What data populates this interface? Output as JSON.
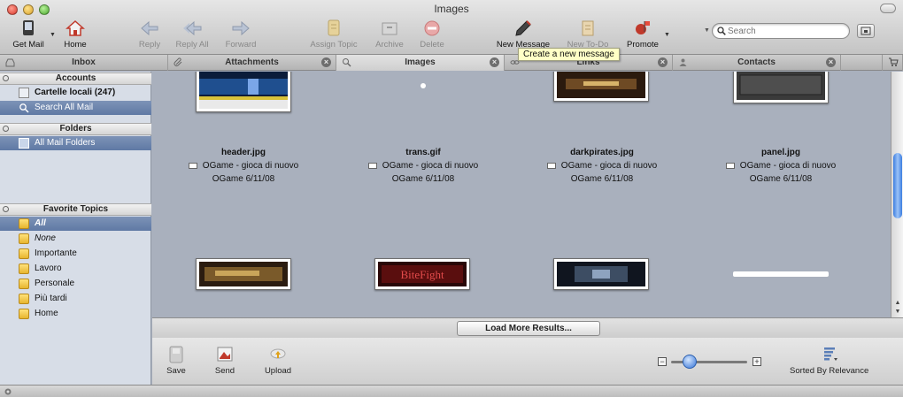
{
  "window": {
    "title": "Images"
  },
  "toolbar": {
    "get_mail": "Get Mail",
    "home": "Home",
    "reply": "Reply",
    "reply_all": "Reply All",
    "forward": "Forward",
    "assign_topic": "Assign Topic",
    "archive": "Archive",
    "delete": "Delete",
    "new_message": "New Message",
    "new_todo": "New To-Do",
    "promote": "Promote",
    "search_placeholder": "Search",
    "tooltip": "Create a new message"
  },
  "tabs": [
    {
      "label": "Inbox",
      "icon": "inbox-icon"
    },
    {
      "label": "Attachments",
      "icon": "paperclip-icon"
    },
    {
      "label": "Images",
      "icon": "image-search-icon"
    },
    {
      "label": "Links",
      "icon": "link-icon"
    },
    {
      "label": "Contacts",
      "icon": "person-icon"
    }
  ],
  "sidebar": {
    "accounts_header": "Accounts",
    "accounts": [
      {
        "label": "Cartelle locali (247)"
      },
      {
        "label": "Search All Mail"
      }
    ],
    "folders_header": "Folders",
    "folders": [
      {
        "label": "All Mail Folders"
      }
    ],
    "topics_header": "Favorite Topics",
    "topics": [
      {
        "label": "All"
      },
      {
        "label": "None"
      },
      {
        "label": "Importante"
      },
      {
        "label": "Lavoro"
      },
      {
        "label": "Personale"
      },
      {
        "label": "Più tardi"
      },
      {
        "label": "Home"
      }
    ]
  },
  "images": [
    {
      "name": "header.jpg",
      "subject": "OGame - gioca di nuovo",
      "sender": "OGame",
      "date": "6/11/08"
    },
    {
      "name": "trans.gif",
      "subject": "OGame - gioca di nuovo",
      "sender": "OGame",
      "date": "6/11/08"
    },
    {
      "name": "darkpirates.jpg",
      "subject": "OGame - gioca di nuovo",
      "sender": "OGame",
      "date": "6/11/08"
    },
    {
      "name": "panel.jpg",
      "subject": "OGame - gioca di nuovo",
      "sender": "OGame",
      "date": "6/11/08"
    }
  ],
  "thumb_text": {
    "bitefight": "BiteFight"
  },
  "load_more": "Load More Results...",
  "bottom": {
    "save": "Save",
    "send": "Send",
    "upload": "Upload",
    "zoom_level": 0.15,
    "sorted_by": "Sorted By Relevance"
  },
  "colors": {
    "selection": "#6a83ad",
    "content_bg": "#a9b0bd",
    "sidebar_bg": "#d7dde7",
    "tooltip_bg": "#ffffc6"
  }
}
